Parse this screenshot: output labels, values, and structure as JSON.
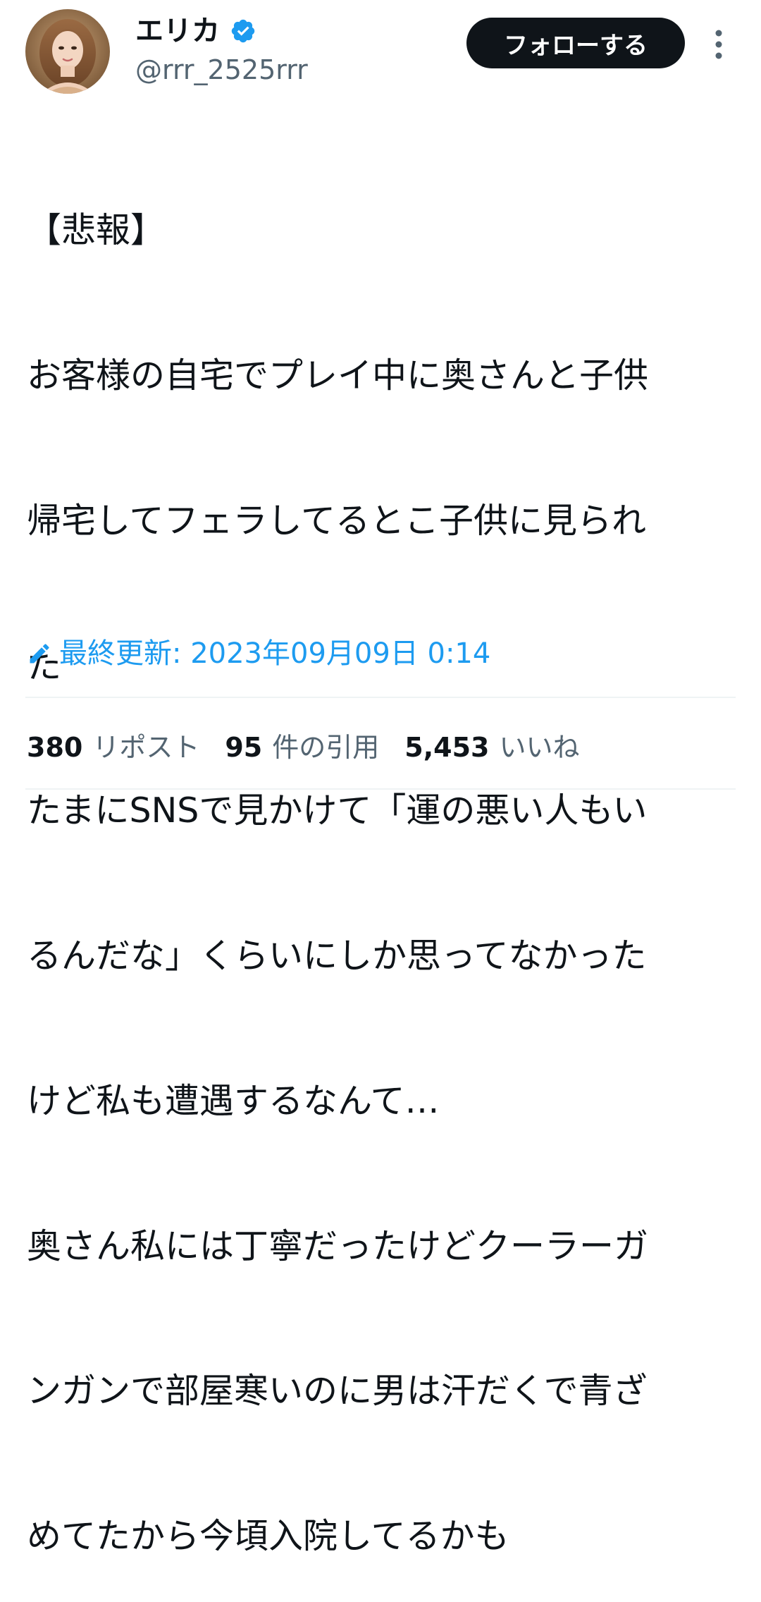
{
  "author": {
    "display_name": "エリカ",
    "handle": "@rrr_2525rrr",
    "avatar_icon": "profile-photo",
    "verified_icon": "verified-badge-icon",
    "verified_color": "#1d9bf0"
  },
  "actions": {
    "follow_label": "フォローする",
    "more_icon": "more-vertical-icon"
  },
  "tweet": {
    "lines": [
      "【悲報】",
      "お客様の自宅でプレイ中に奥さんと子供",
      "帰宅してフェラしてるとこ子供に見られ",
      "た",
      "たまにSNSで見かけて「運の悪い人もい",
      "るんだな」くらいにしか思ってなかった",
      "けど私も遭遇するなんて…",
      "奥さん私には丁寧だったけどクーラーガ",
      "ンガンで部屋寒いのに男は汗だくで青ざ",
      "めてたから今頃入院してるかも"
    ]
  },
  "edited": {
    "icon": "pencil-icon",
    "label": "最終更新: ",
    "timestamp": "2023年09月09日 0:14",
    "color": "#1d9bf0"
  },
  "stats": {
    "reposts_count": "380",
    "reposts_label": "リポスト",
    "quotes_count": "95",
    "quotes_label": "件の引用",
    "likes_count": "5,453",
    "likes_label": "いいね"
  },
  "colors": {
    "text_primary": "#0f1419",
    "text_secondary": "#536471",
    "follow_button_bg": "#0f1419",
    "divider": "#eff3f4"
  }
}
